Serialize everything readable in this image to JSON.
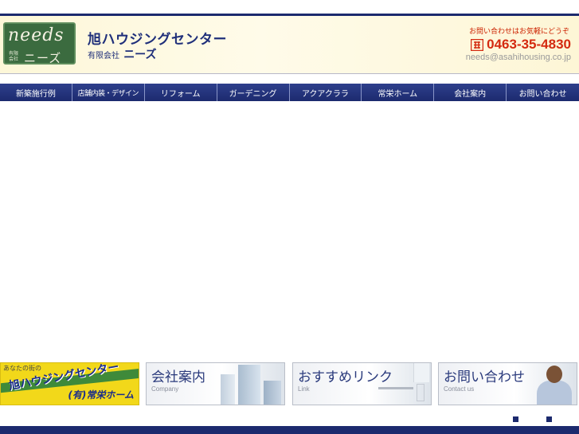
{
  "header": {
    "logo": {
      "word": "needs",
      "kind": "有限会社",
      "kana": "ニーズ"
    },
    "company_name": "旭ハウジングセンター",
    "company_sub_prefix": "有限会社",
    "company_sub_brand": "ニーズ",
    "contact_note": "お問い合わせはお気軽にどうぞ",
    "phone": "0463-35-4830",
    "email": "needs@asahihousing.co.jp"
  },
  "nav": {
    "items": [
      {
        "label": "新築施行例"
      },
      {
        "label": "店舗内装・デザイン"
      },
      {
        "label": "リフォーム"
      },
      {
        "label": "ガーデニング"
      },
      {
        "label": "アクアクララ"
      },
      {
        "label": "常栄ホーム"
      },
      {
        "label": "会社案内"
      },
      {
        "label": "お問い合わせ"
      }
    ]
  },
  "banners": {
    "asahi": {
      "tagline": "あなたの街の",
      "title": "旭ハウジングセンター",
      "brand": "(有)常栄ホーム"
    },
    "company": {
      "title": "会社案内",
      "en": "Company"
    },
    "link": {
      "title": "おすすめリンク",
      "en": "Link"
    },
    "contact": {
      "title": "お問い合わせ",
      "en": "Contact us"
    }
  },
  "colors": {
    "navy": "#1c2a6e",
    "phone_red": "#d42a10",
    "header_bg": "#fdf7d8",
    "banner_yellow": "#f2d81a"
  },
  "icons": {
    "phone": "phone-icon"
  }
}
